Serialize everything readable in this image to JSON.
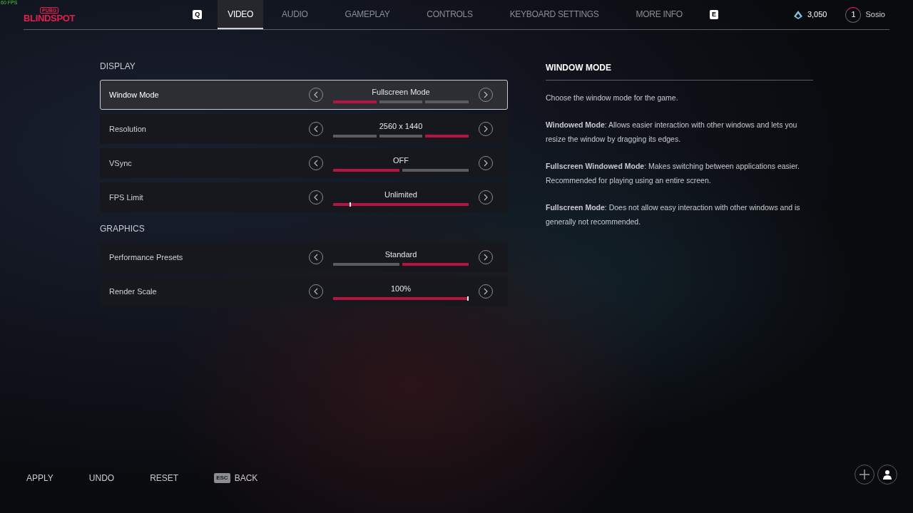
{
  "fps_counter": "60 FPS",
  "logo": {
    "top": "PUBG",
    "main": "BLINDSPOT"
  },
  "tabs_nav": {
    "prev_key": "Q",
    "next_key": "E"
  },
  "tabs": [
    {
      "label": "VIDEO",
      "selected": true
    },
    {
      "label": "AUDIO",
      "selected": false
    },
    {
      "label": "GAMEPLAY",
      "selected": false
    },
    {
      "label": "CONTROLS",
      "selected": false
    },
    {
      "label": "KEYBOARD SETTINGS",
      "selected": false
    },
    {
      "label": "MORE INFO",
      "selected": false
    }
  ],
  "currency": "3,050",
  "profile": {
    "level": "1",
    "name": "Sosio"
  },
  "sections": [
    {
      "title": "DISPLAY",
      "settings": [
        {
          "label": "Window Mode",
          "value": "Fullscreen Mode",
          "selected": true,
          "kind": "segments",
          "segments": [
            {
              "selected": true
            },
            {
              "selected": false
            },
            {
              "selected": false
            }
          ]
        },
        {
          "label": "Resolution",
          "value": "2560 x 1440",
          "selected": false,
          "kind": "segments",
          "segments": [
            {
              "selected": false
            },
            {
              "selected": false
            },
            {
              "selected": true
            }
          ]
        },
        {
          "label": "VSync",
          "value": "OFF",
          "selected": false,
          "kind": "segments",
          "segments": [
            {
              "selected": true
            },
            {
              "selected": false
            }
          ]
        },
        {
          "label": "FPS Limit",
          "value": "Unlimited",
          "selected": false,
          "kind": "slider",
          "level": 0.12
        }
      ]
    },
    {
      "title": "GRAPHICS",
      "settings": [
        {
          "label": "Performance Presets",
          "value": "Standard",
          "selected": false,
          "kind": "segments",
          "segments": [
            {
              "selected": false
            },
            {
              "selected": true
            }
          ]
        },
        {
          "label": "Render Scale",
          "value": "100%",
          "selected": false,
          "kind": "slider",
          "level": 1
        }
      ]
    }
  ],
  "info": {
    "title": "WINDOW MODE",
    "paragraphs": [
      "Choose the window mode for the game.",
      "**Windowed Mode**: Allows easier interaction with other windows and lets you resize the window by dragging its edges.",
      "**Fullscreen Windowed Mode**: Makes switching between applications easier. Recommended for playing using an entire screen.",
      "**Fullscreen Mode**: Does not allow easy interaction with other windows and is generally not recommended."
    ]
  },
  "footer": [
    {
      "label": "APPLY"
    },
    {
      "label": "UNDO"
    },
    {
      "label": "RESET"
    },
    {
      "label": "BACK",
      "key": "ESC"
    }
  ]
}
